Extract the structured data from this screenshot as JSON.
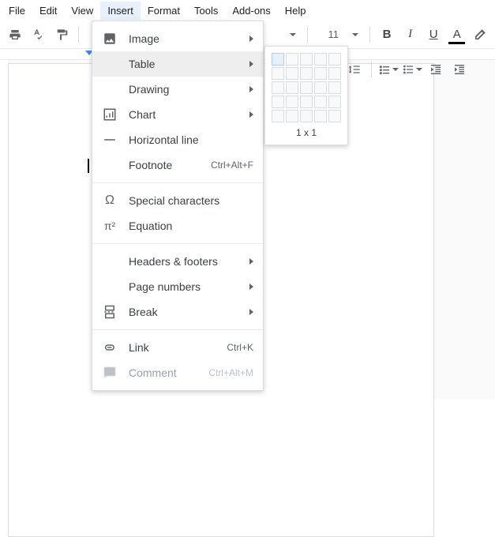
{
  "menubar": {
    "items": [
      "File",
      "Edit",
      "View",
      "Insert",
      "Format",
      "Tools",
      "Add-ons",
      "Help"
    ],
    "active_index": 3
  },
  "toolbar": {
    "font_size": "11"
  },
  "insert_menu": {
    "image": {
      "label": "Image"
    },
    "table": {
      "label": "Table"
    },
    "drawing": {
      "label": "Drawing"
    },
    "chart": {
      "label": "Chart"
    },
    "hr": {
      "label": "Horizontal line"
    },
    "footnote": {
      "label": "Footnote",
      "shortcut": "Ctrl+Alt+F"
    },
    "special": {
      "label": "Special characters"
    },
    "equation": {
      "label": "Equation"
    },
    "headers": {
      "label": "Headers & footers"
    },
    "pagenum": {
      "label": "Page numbers"
    },
    "break": {
      "label": "Break"
    },
    "link": {
      "label": "Link",
      "shortcut": "Ctrl+K"
    },
    "comment": {
      "label": "Comment",
      "shortcut": "Ctrl+Alt+M"
    }
  },
  "table_picker": {
    "rows": 5,
    "cols": 5,
    "sel_rows": 1,
    "sel_cols": 1,
    "label": "1 x 1"
  }
}
